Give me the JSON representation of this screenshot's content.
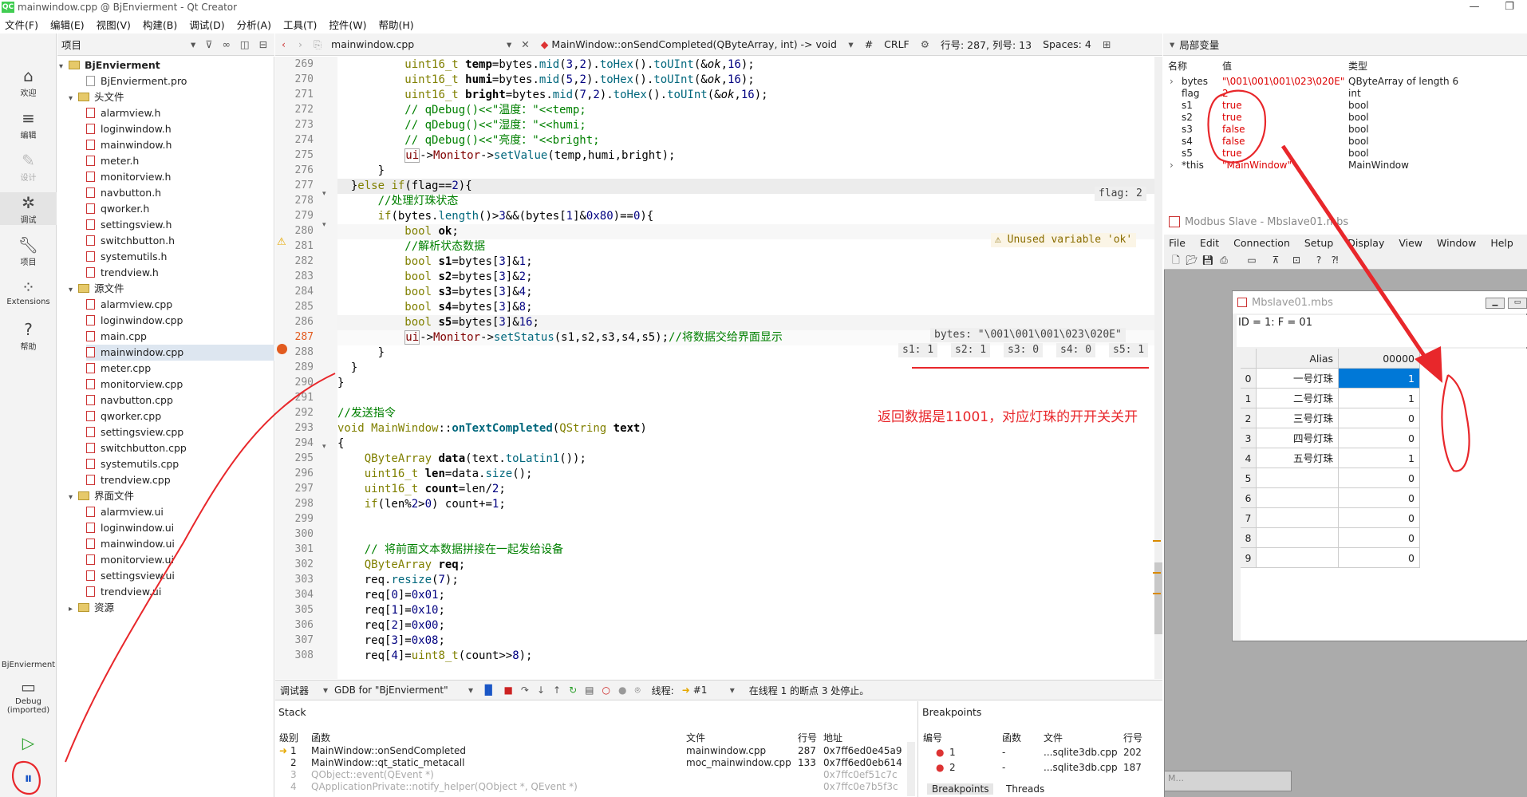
{
  "window": {
    "title": "mainwindow.cpp @ BjEnvierment - Qt Creator"
  },
  "menubar": [
    "文件(F)",
    "编辑(E)",
    "视图(V)",
    "构建(B)",
    "调试(D)",
    "分析(A)",
    "工具(T)",
    "控件(W)",
    "帮助(H)"
  ],
  "modes": [
    {
      "label": "欢迎",
      "icon": "home-icon"
    },
    {
      "label": "编辑",
      "icon": "edit-icon"
    },
    {
      "label": "设计",
      "icon": "design-icon"
    },
    {
      "label": "调试",
      "icon": "debug-icon"
    },
    {
      "label": "项目",
      "icon": "wrench-icon"
    },
    {
      "label": "Extensions",
      "icon": "extensions-icon"
    },
    {
      "label": "帮助",
      "icon": "help-icon"
    }
  ],
  "kit": {
    "project": "BjEnvierment",
    "config": "Debug (imported)"
  },
  "project_panel": {
    "title": "项目",
    "root": "BjEnvierment",
    "pro": "BjEnvierment.pro",
    "headers_label": "头文件",
    "headers": [
      "alarmview.h",
      "loginwindow.h",
      "mainwindow.h",
      "meter.h",
      "monitorview.h",
      "navbutton.h",
      "qworker.h",
      "settingsview.h",
      "switchbutton.h",
      "systemutils.h",
      "trendview.h"
    ],
    "sources_label": "源文件",
    "sources": [
      "alarmview.cpp",
      "loginwindow.cpp",
      "main.cpp",
      "mainwindow.cpp",
      "meter.cpp",
      "monitorview.cpp",
      "navbutton.cpp",
      "qworker.cpp",
      "settingsview.cpp",
      "switchbutton.cpp",
      "systemutils.cpp",
      "trendview.cpp"
    ],
    "forms_label": "界面文件",
    "forms": [
      "alarmview.ui",
      "loginwindow.ui",
      "mainwindow.ui",
      "monitorview.ui",
      "settingsview.ui",
      "trendview.ui"
    ],
    "resources_label": "资源"
  },
  "editor": {
    "file": "mainwindow.cpp",
    "function": "MainWindow::onSendCompleted(QByteArray, int) -> void",
    "hash": "#",
    "eol": "CRLF",
    "position": "行号: 287, 列号: 13",
    "spaces": "Spaces: 4",
    "line_numbers": [
      "269",
      "270",
      "271",
      "272",
      "273",
      "274",
      "275",
      "276",
      "277",
      "278",
      "279",
      "280",
      "281",
      "282",
      "283",
      "284",
      "285",
      "286",
      "287",
      "288",
      "289",
      "290",
      "291",
      "292",
      "293",
      "294",
      "295",
      "296",
      "297",
      "298",
      "299",
      "300",
      "301",
      "302",
      "303",
      "304",
      "305",
      "306",
      "307",
      "308"
    ],
    "hints": {
      "flag": "flag: 2",
      "unused": "⚠ Unused variable 'ok'",
      "bytes": "bytes: \"\\001\\001\\001\\023\\020E\"",
      "s1": "s1: 1",
      "s2": "s2: 1",
      "s3": "s3: 0",
      "s4": "s4: 0",
      "s5": "s5: 1"
    }
  },
  "annotation": "返回数据是11001，对应灯珠的开开关关开",
  "debug_toolbar": {
    "view": "调试器",
    "engine": "GDB for \"BjEnvierment\"",
    "thread_label": "线程:",
    "thread": "#1",
    "status": "在线程 1 的断点 3 处停止。"
  },
  "stack": {
    "title": "Stack",
    "columns": [
      "级别",
      "函数",
      "文件",
      "行号",
      "地址"
    ],
    "rows": [
      {
        "level": "1",
        "func": "MainWindow::onSendCompleted",
        "file": "mainwindow.cpp",
        "line": "287",
        "addr": "0x7ff6ed0e45a9"
      },
      {
        "level": "2",
        "func": "MainWindow::qt_static_metacall",
        "file": "moc_mainwindow.cpp",
        "line": "133",
        "addr": "0x7ff6ed0eb614"
      },
      {
        "level": "3",
        "func": "QObject::event(QEvent *)",
        "file": "",
        "line": "",
        "addr": "0x7ffc0ef51c7c"
      },
      {
        "level": "4",
        "func": "QApplicationPrivate::notify_helper(QObject *, QEvent *)",
        "file": "",
        "line": "",
        "addr": "0x7ffc0e7b5f3c"
      }
    ]
  },
  "breakpoints": {
    "title": "Breakpoints",
    "columns": [
      "编号",
      "函数",
      "文件",
      "行号"
    ],
    "rows": [
      {
        "no": "1",
        "func": "-",
        "file": "...sqlite3db.cpp",
        "line": "202"
      },
      {
        "no": "2",
        "func": "-",
        "file": "...sqlite3db.cpp",
        "line": "187"
      }
    ],
    "tabs": [
      "Breakpoints",
      "Threads"
    ]
  },
  "locals": {
    "title": "局部变量",
    "columns": [
      "名称",
      "值",
      "类型"
    ],
    "rows": [
      {
        "name": "bytes",
        "value": "\"\\001\\001\\001\\023\\020E\"",
        "type": "QByteArray of length 6"
      },
      {
        "name": "flag",
        "value": "2",
        "type": "int"
      },
      {
        "name": "s1",
        "value": "true",
        "type": "bool"
      },
      {
        "name": "s2",
        "value": "true",
        "type": "bool"
      },
      {
        "name": "s3",
        "value": "false",
        "type": "bool"
      },
      {
        "name": "s4",
        "value": "false",
        "type": "bool"
      },
      {
        "name": "s5",
        "value": "true",
        "type": "bool"
      },
      {
        "name": "*this",
        "value": "\"MainWindow\"",
        "type": "MainWindow"
      }
    ]
  },
  "modbus": {
    "title": "Modbus Slave - Mbslave01.mbs",
    "menu": [
      "File",
      "Edit",
      "Connection",
      "Setup",
      "Display",
      "View",
      "Window",
      "Help"
    ],
    "child_title": "Mbslave01.mbs",
    "id_line": "ID = 1: F = 01",
    "alias_header": "Alias",
    "addr_header": "00000",
    "rows": [
      {
        "idx": "0",
        "alias": "一号灯珠",
        "val": "1"
      },
      {
        "idx": "1",
        "alias": "二号灯珠",
        "val": "1"
      },
      {
        "idx": "2",
        "alias": "三号灯珠",
        "val": "0"
      },
      {
        "idx": "3",
        "alias": "四号灯珠",
        "val": "0"
      },
      {
        "idx": "4",
        "alias": "五号灯珠",
        "val": "1"
      },
      {
        "idx": "5",
        "alias": "",
        "val": "0"
      },
      {
        "idx": "6",
        "alias": "",
        "val": "0"
      },
      {
        "idx": "7",
        "alias": "",
        "val": "0"
      },
      {
        "idx": "8",
        "alias": "",
        "val": "0"
      },
      {
        "idx": "9",
        "alias": "",
        "val": "0"
      }
    ],
    "taskbar": "M..."
  },
  "colors": {
    "annotation": "#e8272b",
    "selection": "#0078d7"
  }
}
